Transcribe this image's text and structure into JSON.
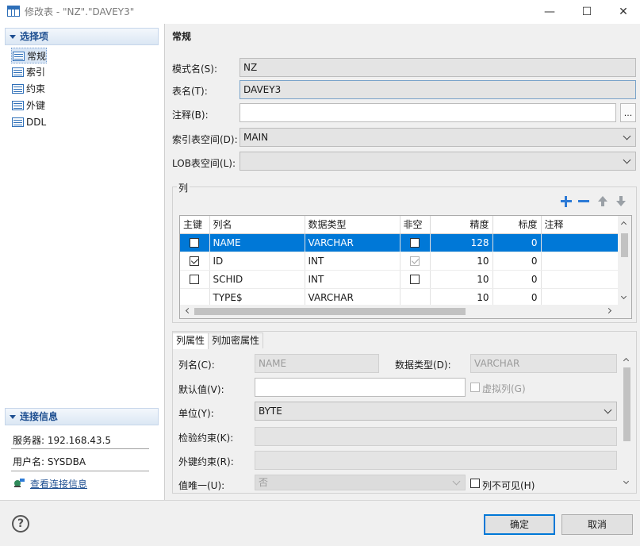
{
  "window": {
    "title": "修改表 - \"NZ\".\"DAVEY3\"",
    "minimize": "—",
    "maximize": "☐",
    "close": "✕"
  },
  "sidebar": {
    "header": "选择项",
    "items": [
      {
        "label": "常规",
        "selected": true
      },
      {
        "label": "索引"
      },
      {
        "label": "约束"
      },
      {
        "label": "外键"
      },
      {
        "label": "DDL"
      }
    ],
    "conn_header": "连接信息",
    "server": "服务器: 192.168.43.5",
    "user": "用户名: SYSDBA",
    "view_link": "查看连接信息"
  },
  "general": {
    "title": "常规",
    "schema_label": "模式名(S):",
    "schema_value": "NZ",
    "table_label": "表名(T):",
    "table_value": "DAVEY3",
    "comment_label": "注释(B):",
    "comment_value": "",
    "ellipsis": "...",
    "idx_ts_label": "索引表空间(D):",
    "idx_ts_value": "MAIN",
    "lob_ts_label": "LOB表空间(L):",
    "lob_ts_value": ""
  },
  "columns": {
    "group_title": "列",
    "headers": [
      "主键",
      "列名",
      "数据类型",
      "非空",
      "精度",
      "标度",
      "注释"
    ],
    "rows": [
      {
        "pk": false,
        "name": "NAME",
        "type": "VARCHAR",
        "notnull": false,
        "precision": "128",
        "scale": "0",
        "comment": "",
        "selected": true
      },
      {
        "pk": true,
        "name": "ID",
        "type": "INT",
        "notnull": true,
        "precision": "10",
        "scale": "0",
        "comment": "",
        "notnull_disabled": true
      },
      {
        "pk": false,
        "name": "SCHID",
        "type": "INT",
        "notnull": false,
        "precision": "10",
        "scale": "0",
        "comment": ""
      },
      {
        "pk": null,
        "name": "TYPE$",
        "type": "VARCHAR",
        "notnull": null,
        "precision": "10",
        "scale": "0",
        "comment": ""
      }
    ]
  },
  "props": {
    "tab1": "列属性",
    "tab2": "列加密属性",
    "colname_label": "列名(C):",
    "colname_value": "NAME",
    "datatype_label": "数据类型(D):",
    "datatype_value": "VARCHAR",
    "default_label": "默认值(V):",
    "default_value": "",
    "virtual_label": "虚拟列(G)",
    "unit_label": "单位(Y):",
    "unit_value": "BYTE",
    "check_label": "检验约束(K):",
    "check_value": "",
    "fk_label": "外键约束(R):",
    "fk_value": "",
    "unique_label": "值唯一(U):",
    "unique_value": "否",
    "invisible_label": "列不可见(H)"
  },
  "buttons": {
    "help": "?",
    "ok": "确定",
    "cancel": "取消"
  },
  "colors": {
    "accent": "#0078d7",
    "header_text": "#1e4f91",
    "icon_blue": "#2c7ad6"
  }
}
